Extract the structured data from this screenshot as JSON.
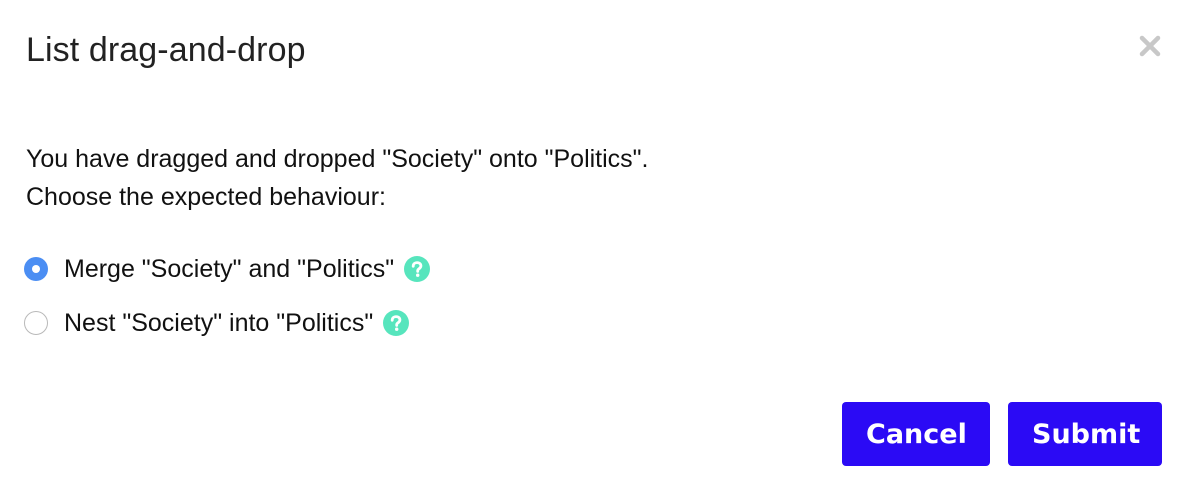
{
  "dialog": {
    "title": "List drag-and-drop",
    "close_icon": "close-icon"
  },
  "message": {
    "line1": "You have dragged and dropped \"Society\" onto \"Politics\".",
    "line2": "Choose the expected behaviour:"
  },
  "options": [
    {
      "label": "Merge \"Society\" and \"Politics\"",
      "selected": true,
      "help_icon": "question-circle-icon"
    },
    {
      "label": "Nest \"Society\" into \"Politics\"",
      "selected": false,
      "help_icon": "question-circle-icon"
    }
  ],
  "buttons": {
    "cancel_label": "Cancel",
    "submit_label": "Submit"
  },
  "colors": {
    "button_bg": "#2b0af5",
    "radio_selected": "#4b8ef3",
    "help_icon": "#57e5bd"
  }
}
